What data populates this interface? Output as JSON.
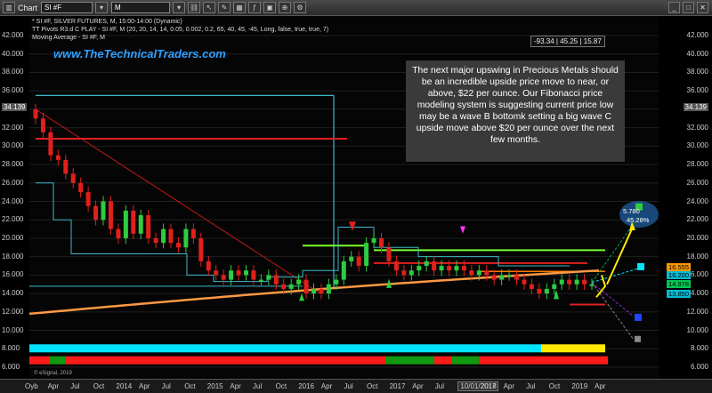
{
  "window": {
    "title": "Chart",
    "symbol": "SI #F",
    "interval": "M"
  },
  "chart_header": {
    "line1": "* SI #F, SILVER FUTURES, M, 15:00-14:00 (Dynamic)",
    "line2": "TT Pivots R3.d C PLAY - SI #F, M (20, 20, 14, 14, 0.05, 0.002, 0.2, 65, 40, 45, -45, Long, false, true, true, 7)",
    "line3": "Moving Average - SI #F, M"
  },
  "readout": "-93.34 | 45.25 | 15.87",
  "watermark": "www.TheTechnicalTraders.com",
  "annotation": "The next major upswing in Precious Metals should be an incredible upside price move to near, or above, $22 per ounce.  Our Fibonacci price modeling system is suggesting current price low may be a wave B bottomk setting a big wave C upside move above $20 per ounce over the next few months.",
  "forecast": {
    "value": "5.780",
    "percent": "45.28%"
  },
  "left_axis": [
    "42.000",
    "40.000",
    "38.000",
    "36.000",
    "34.139",
    "32.000",
    "30.000",
    "28.000",
    "26.000",
    "24.000",
    "22.000",
    "20.000",
    "18.000",
    "16.000",
    "14.000",
    "12.000",
    "10.000",
    "8.000",
    "6.000"
  ],
  "right_axis": [
    "42.000",
    "40.000",
    "38.000",
    "36.000",
    "34.139",
    "32.000",
    "30.000",
    "28.000",
    "26.000",
    "24.000",
    "22.000",
    "20.000",
    "18.000",
    "16.000",
    "14.000",
    "12.000",
    "10.000",
    "8.000",
    "6.000"
  ],
  "price_tags": [
    {
      "text": "16.555",
      "bg": "#ff9900",
      "fg": "#000"
    },
    {
      "text": "16.200",
      "bg": "#00bcd4",
      "fg": "#000"
    },
    {
      "text": "14.978",
      "bg": "#00c853",
      "fg": "#000"
    },
    {
      "text": "13.850",
      "bg": "#00bcd4",
      "fg": "#000"
    }
  ],
  "x_axis": [
    "Oyb",
    "Apr",
    "Jul",
    "Oct",
    "2014",
    "Apr",
    "Jul",
    "Oct",
    "2015",
    "Apr",
    "Jul",
    "Oct",
    "2016",
    "Apr",
    "Jul",
    "Oct",
    "2017",
    "Apr",
    "Jul",
    "10/01/2017",
    "2018",
    "Apr",
    "Jul",
    "Oct",
    "2019",
    "Apr"
  ],
  "copyright": "© eSignal, 2019",
  "colors": {
    "up": "#2ecc40",
    "down": "#e0201c",
    "cyan_line": "#3fb8c8",
    "ma": "#ff9944",
    "note_bg": "#3a3a3a",
    "watermark": "#2fa0ff"
  },
  "chart_data": {
    "type": "candlestick",
    "title": "SILVER FUTURES (SI #F), Monthly",
    "ylim": [
      6,
      42
    ],
    "xlabels": [
      "Oyb",
      "Apr",
      "Jul",
      "Oct",
      "2014",
      "Apr",
      "Jul",
      "Oct",
      "2015",
      "Apr",
      "Jul",
      "Oct",
      "2016",
      "Apr",
      "Jul",
      "Oct",
      "2017",
      "Apr",
      "Jul",
      "10/01/2017",
      "2018",
      "Apr",
      "Jul",
      "Oct",
      "2019",
      "Apr"
    ],
    "candles_close": [
      33.0,
      31.5,
      29.0,
      28.5,
      27.0,
      26.0,
      25.0,
      23.5,
      22.0,
      24.0,
      21.0,
      20.0,
      23.0,
      20.5,
      22.5,
      20.0,
      19.5,
      21.0,
      19.5,
      19.0,
      21.0,
      20.0,
      17.5,
      16.5,
      16.0,
      15.5,
      16.5,
      16.0,
      16.5,
      15.5,
      15.5,
      16.0,
      15.0,
      14.5,
      15.0,
      15.5,
      14.0,
      14.5,
      14.0,
      15.0,
      15.5,
      17.5,
      18.0,
      17.0,
      19.5,
      20.0,
      19.0,
      17.5,
      16.5,
      16.0,
      16.5,
      17.0,
      17.5,
      16.5,
      17.0,
      16.5,
      17.0,
      16.5,
      16.0,
      16.5,
      16.0,
      15.5,
      16.0,
      16.0,
      15.5,
      15.0,
      14.5,
      14.0,
      14.5,
      15.0,
      15.5,
      15.0,
      15.5,
      15.0,
      15.0
    ],
    "forecast_target": 22.0,
    "forecast_percent": "45.28%"
  }
}
